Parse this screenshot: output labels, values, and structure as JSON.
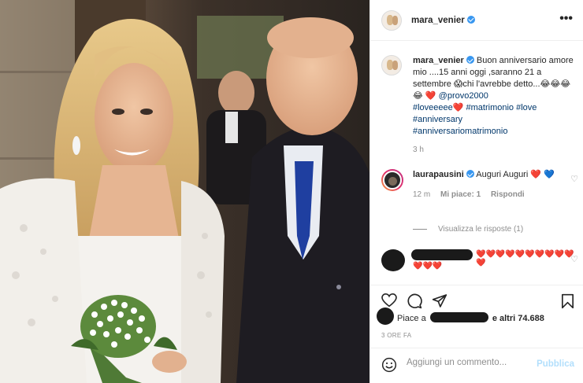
{
  "colors": {
    "accent": "#3897f0",
    "heart": "#e0233a",
    "secondary_text": "#8e8e8e",
    "link": "#00376b",
    "publish_disabled": "#b2dffc"
  },
  "header": {
    "username": "mara_venier",
    "verified_icon": "verified-badge-icon",
    "more_label": "•••"
  },
  "caption": {
    "username": "mara_venier",
    "text_1": "Buon anniversario amore mio ....15 anni oggi ,saranno 21 a settembre 😱chi l'avrebbe detto...😂😂😂😂 ❤️ ",
    "mention": "@provo2000",
    "tags": [
      "#loveeeee❤️",
      "#matrimonio",
      "#love",
      "#anniversary",
      "#anniversariomatrimonio"
    ],
    "time": "3 h"
  },
  "comments": [
    {
      "username": "laurapausini",
      "text": "Auguri Auguri ❤️ 💙",
      "time": "12 m",
      "likes": "Mi piace: 1",
      "reply": "Rispondi",
      "view_replies": "Visualizza le risposte (1)"
    },
    {
      "hearts": "❤️❤️❤️❤️❤️❤️❤️❤️❤️❤️❤️",
      "hearts_2": "❤️❤️❤️"
    }
  ],
  "actions": {
    "like_icon": "heart-icon",
    "comment_icon": "comment-icon",
    "share_icon": "share-icon",
    "save_icon": "bookmark-icon"
  },
  "likes": {
    "prefix": "Piace a",
    "suffix": "e altri 74.688"
  },
  "date": "3 ORE FA",
  "add_comment": {
    "placeholder": "Aggiungi un commento...",
    "publish": "Pubblica",
    "emoji_icon": "emoji-icon"
  }
}
